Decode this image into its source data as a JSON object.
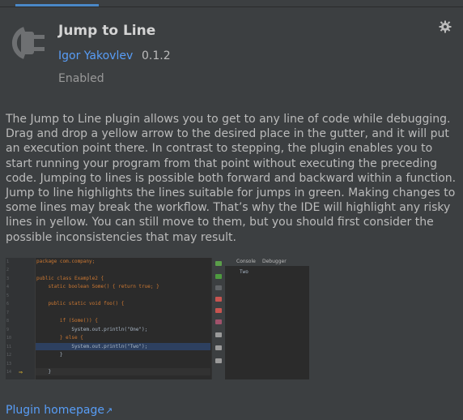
{
  "plugin": {
    "title": "Jump to Line",
    "vendor": "Igor Yakovlev",
    "version": "0.1.2",
    "status": "Enabled",
    "description": "The Jump to Line plugin allows you to get to any line of code while debugging. Drag and drop a yellow arrow to the desired place in the gutter, and it will put an execution point there. In contrast to stepping, the plugin enables you to start running your program from that point without executing the preceding code. Jumping to lines is possible both forward and backward within a function. Jump to line highlights the lines suitable for jumps in green. Making changes to some lines may break the workflow. That’s why the IDE will highlight any risky lines in yellow. You can still move to them, but you should first consider the possible inconsistencies that may result.",
    "homepage_label": "Plugin homepage",
    "homepage_arrow": "↗"
  },
  "screenshot": {
    "line_numbers": [
      "1",
      "2",
      "3",
      "4",
      "5",
      "6",
      "7",
      "8",
      "9",
      "10",
      "11",
      "12",
      "13",
      "14"
    ],
    "code_lines": [
      "package com.company;",
      "",
      "public class Example2 {",
      "    static boolean Some() { return true; }",
      "",
      "    public static void foo() {",
      "",
      "        if (Some()) {",
      "            System.out.println(\"One\");",
      "        } else {",
      "            System.out.println(\"Two\");",
      "        }",
      "",
      "    }"
    ],
    "panel_tabs": [
      "Console",
      "Debugger"
    ],
    "console_output": "Two",
    "jump_arrow": "⇒"
  },
  "colors": {
    "background": "#3c3f41",
    "link": "#589df6",
    "text": "#bbbbbb",
    "accent_tab": "#4a88c7"
  }
}
